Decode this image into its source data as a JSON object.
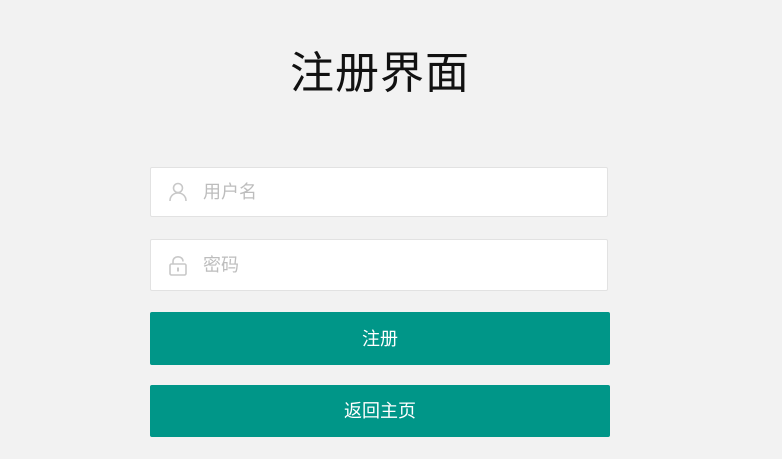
{
  "page": {
    "title": "注册界面"
  },
  "form": {
    "username": {
      "placeholder": "用户名",
      "value": "",
      "icon": "user-icon"
    },
    "password": {
      "placeholder": "密码",
      "value": "",
      "icon": "lock-icon"
    },
    "register_label": "注册",
    "home_label": "返回主页"
  },
  "colors": {
    "background": "#f2f2f2",
    "primary": "#009688",
    "placeholder": "#bdbdbd",
    "icon": "#c8c8c8"
  }
}
